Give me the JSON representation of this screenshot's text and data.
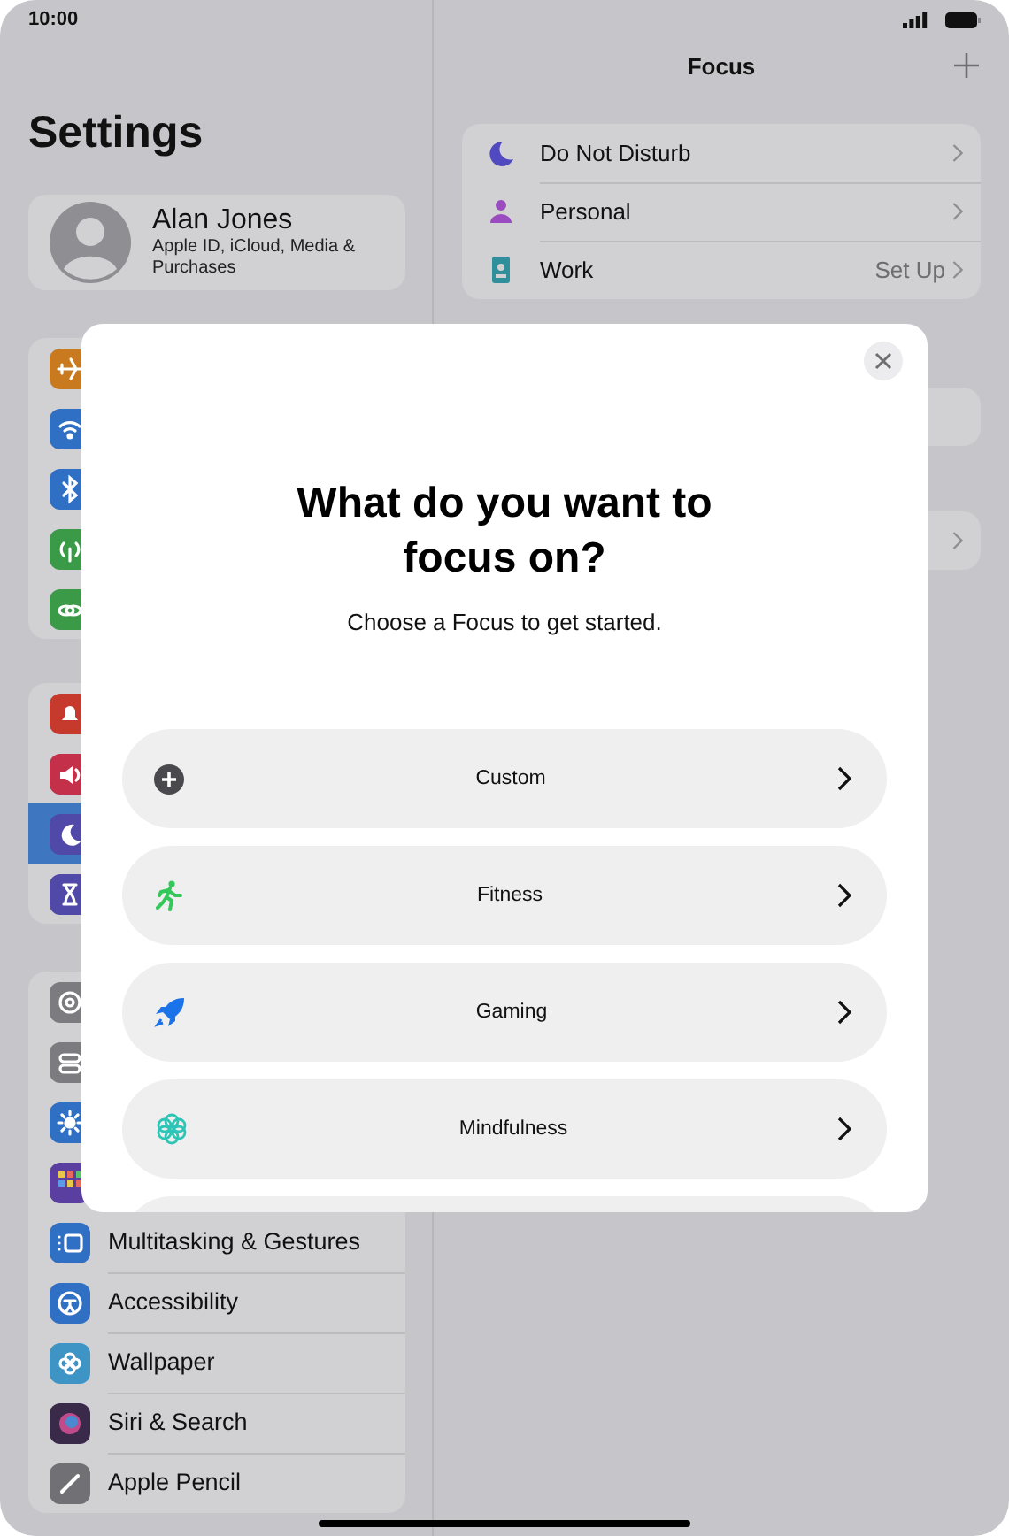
{
  "status_bar": {
    "time": "10:00"
  },
  "sidebar": {
    "title": "Settings",
    "profile": {
      "name": "Alan Jones",
      "subtitle": "Apple ID, iCloud, Media & Purchases"
    },
    "groups": [
      {
        "items": [
          {
            "kind": "airplane",
            "color": "#c97a1e",
            "selected": false
          },
          {
            "kind": "wifi",
            "color": "#2f6fc4",
            "selected": false
          },
          {
            "kind": "bluetooth",
            "color": "#2f6fc4",
            "selected": false
          },
          {
            "kind": "antenna",
            "color": "#3a9a48",
            "selected": false
          },
          {
            "kind": "link",
            "color": "#3a9a48",
            "selected": false
          }
        ]
      },
      {
        "items": [
          {
            "kind": "bell",
            "color": "#c63a2e",
            "selected": false
          },
          {
            "kind": "speaker",
            "color": "#c4304a",
            "selected": false
          },
          {
            "kind": "moon",
            "color": "#5049a8",
            "selected": true
          },
          {
            "kind": "hourglass",
            "color": "#5049a8",
            "selected": false
          }
        ]
      },
      {
        "items": [
          {
            "kind": "gear",
            "color": "#7b7b80",
            "selected": false
          },
          {
            "kind": "switches",
            "color": "#7b7b80",
            "selected": false
          },
          {
            "kind": "sun",
            "color": "#2f6fc4",
            "selected": false
          },
          {
            "kind": "grid",
            "color": "#5a3fa0",
            "selected": false
          },
          {
            "kind": "window",
            "color": "#2f6fc4",
            "label": "Multitasking & Gestures",
            "selected": false
          },
          {
            "kind": "person",
            "color": "#2f6fc4",
            "label": "Accessibility",
            "selected": false
          },
          {
            "kind": "flower",
            "color": "#3e94c4",
            "label": "Wallpaper",
            "selected": false
          },
          {
            "kind": "orb",
            "color": "#3a2a4a",
            "label": "Siri & Search",
            "selected": false
          },
          {
            "kind": "pencil",
            "color": "#707075",
            "label": "Apple Pencil",
            "selected": false
          }
        ]
      }
    ]
  },
  "detail": {
    "title": "Focus",
    "rows": [
      {
        "kind": "moon",
        "color": "#5049c0",
        "label": "Do Not Disturb"
      },
      {
        "kind": "person",
        "color": "#9a4bc0",
        "label": "Personal"
      },
      {
        "kind": "badge",
        "color": "#2f8f9a",
        "label": "Work",
        "value": "Set Up"
      }
    ]
  },
  "modal": {
    "title": "What do you want to focus on?",
    "subtitle": "Choose a Focus to get started.",
    "options": [
      {
        "kind": "plus",
        "label": "Custom"
      },
      {
        "kind": "runner",
        "label": "Fitness"
      },
      {
        "kind": "rocket",
        "label": "Gaming"
      },
      {
        "kind": "flower",
        "label": "Mindfulness"
      }
    ]
  }
}
